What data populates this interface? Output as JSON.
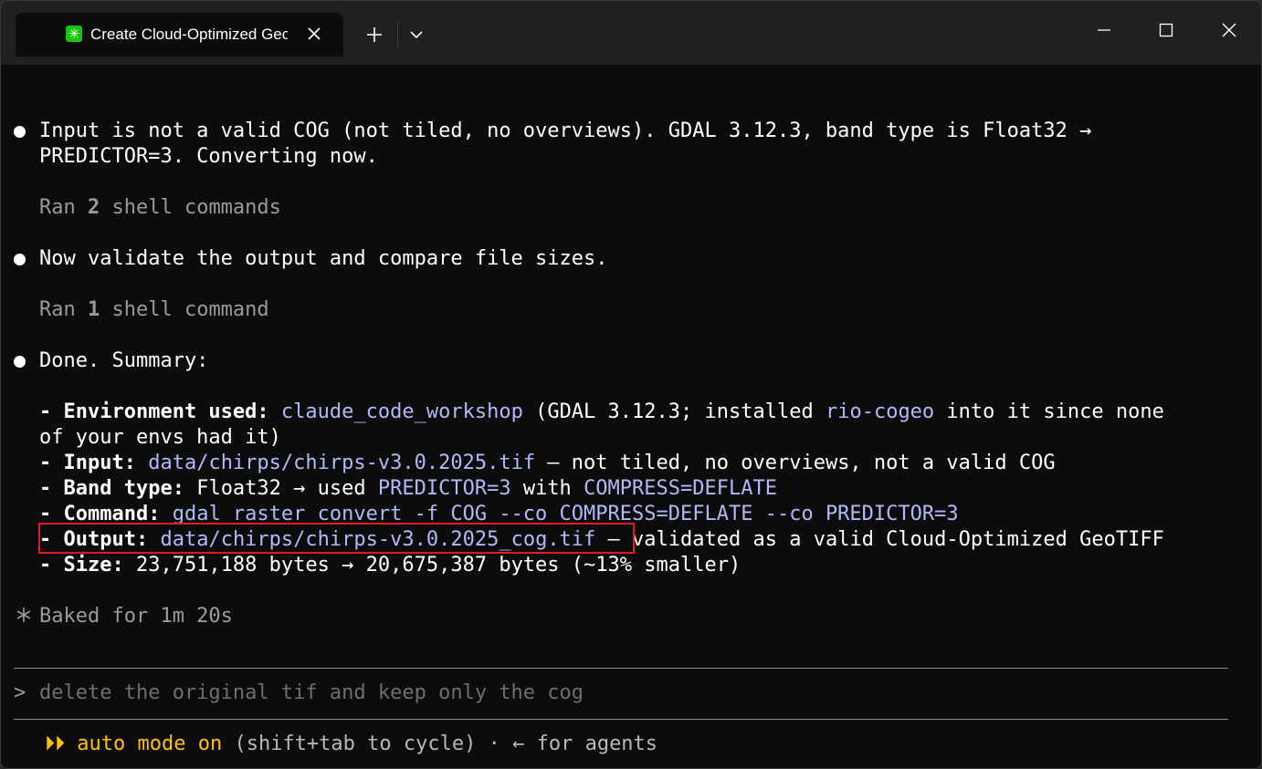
{
  "tab": {
    "title": "Create Cloud-Optimized GeoTIFF",
    "icon": "sparkle-badge-icon"
  },
  "colors": {
    "accent_link": "#b1b9f9",
    "highlight_box": "#e01b24",
    "auto_mode": "#ffc107",
    "tab_badge": "#16c60c"
  },
  "messages": {
    "m1_line1": "Input is not a valid COG (not tiled, no overviews). GDAL 3.12.3, band type is Float32 →",
    "m1_line2": "PREDICTOR=3. Converting now.",
    "ran1_prefix": "Ran ",
    "ran1_count": "2",
    "ran1_suffix": " shell commands",
    "m2": "Now validate the output and compare file sizes.",
    "ran2_prefix": "Ran ",
    "ran2_count": "1",
    "ran2_suffix": " shell command",
    "m3": "Done. Summary:"
  },
  "summary": {
    "env_label": "- Environment used:",
    "env_value": "claude_code_workshop",
    "env_mid": " (GDAL 3.12.3; installed ",
    "env_pkg": "rio-cogeo",
    "env_tail": " into it since none",
    "env_line2": "of your envs had it)",
    "input_label": "- Input:",
    "input_path": "data/chirps/chirps-v3.0.2025.tif",
    "input_tail": " — not tiled, no overviews, not a valid COG",
    "band_label": "- Band type:",
    "band_text": " Float32 → used ",
    "band_predictor": "PREDICTOR=3",
    "band_with": " with ",
    "band_compress": "COMPRESS=DEFLATE",
    "cmd_label": "- Command:",
    "cmd_value": "gdal raster convert -f COG --co COMPRESS=DEFLATE --co PREDICTOR=3",
    "output_label": "- Output:",
    "output_path": "data/chirps/chirps-v3.0.2025_cog.tif",
    "output_tail": " — validated as a valid Cloud-Optimized GeoTIFF",
    "size_label": "- Size:",
    "size_value": " 23,751,188 bytes → 20,675,387 bytes (~13% smaller)"
  },
  "status": {
    "baked": "Baked for 1m 20s"
  },
  "prompt": {
    "symbol": ">",
    "placeholder": "delete the original tif and keep only the cog"
  },
  "footer": {
    "arrows": "⏵⏵",
    "mode": "auto mode on",
    "hint": " (shift+tab to cycle) · ← for agents"
  }
}
